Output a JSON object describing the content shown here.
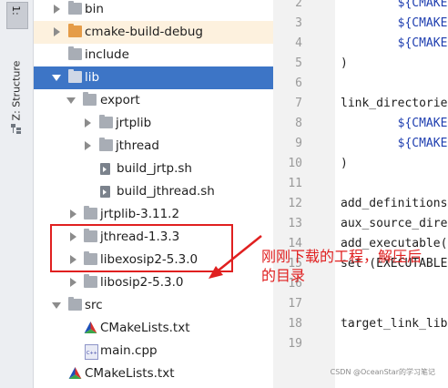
{
  "side_strip": {
    "tab_top_label": "1:",
    "structure_label": "Z: Structure"
  },
  "tree": {
    "rows": [
      {
        "label": "bin",
        "expanded": false,
        "icon": "folder-icon"
      },
      {
        "label": "cmake-build-debug",
        "expanded": false,
        "icon": "folder-icon"
      },
      {
        "label": "include",
        "icon": "folder-icon"
      },
      {
        "label": "lib",
        "expanded": true,
        "icon": "folder-icon",
        "selected": true
      },
      {
        "label": "export",
        "expanded": true,
        "icon": "folder-icon"
      },
      {
        "label": "jrtplib",
        "expanded": false,
        "icon": "folder-icon"
      },
      {
        "label": "jthread",
        "expanded": false,
        "icon": "folder-icon"
      },
      {
        "label": "build_jrtp.sh",
        "icon": "shell-file-icon"
      },
      {
        "label": "build_jthread.sh",
        "icon": "shell-file-icon"
      },
      {
        "label": "jrtplib-3.11.2",
        "expanded": false,
        "icon": "folder-icon"
      },
      {
        "label": "jthread-1.3.3",
        "expanded": false,
        "icon": "folder-icon"
      },
      {
        "label": "libexosip2-5.3.0",
        "expanded": false,
        "icon": "folder-icon"
      },
      {
        "label": "libosip2-5.3.0",
        "expanded": false,
        "icon": "folder-icon"
      },
      {
        "label": "src",
        "expanded": true,
        "icon": "folder-icon"
      },
      {
        "label": "CMakeLists.txt",
        "icon": "cmake-file-icon"
      },
      {
        "label": "main.cpp",
        "icon": "cpp-file-icon"
      },
      {
        "label": "CMakeLists.txt",
        "icon": "cmake-file-icon"
      }
    ]
  },
  "editor": {
    "line_numbers": [
      "2",
      "3",
      "4",
      "5",
      "6",
      "7",
      "8",
      "9",
      "10",
      "11",
      "12",
      "13",
      "14",
      "15",
      "16",
      "17",
      "18",
      "19"
    ],
    "lines": [
      {
        "indent": "        ",
        "text": "${CMAKE",
        "kind": "var"
      },
      {
        "indent": "        ",
        "text": "${CMAKE",
        "kind": "var"
      },
      {
        "indent": "        ",
        "text": "${CMAKE",
        "kind": "var"
      },
      {
        "indent": "",
        "text": ")",
        "kind": "plain"
      },
      {
        "indent": "",
        "text": "",
        "kind": "plain"
      },
      {
        "indent": "",
        "text": "link_directorie",
        "kind": "plain"
      },
      {
        "indent": "        ",
        "text": "${CMAKE",
        "kind": "var"
      },
      {
        "indent": "        ",
        "text": "${CMAKE",
        "kind": "var"
      },
      {
        "indent": "",
        "text": ")",
        "kind": "plain"
      },
      {
        "indent": "",
        "text": "",
        "kind": "plain"
      },
      {
        "indent": "",
        "text": "add_definitions",
        "kind": "plain"
      },
      {
        "indent": "",
        "text": "aux_source_dire",
        "kind": "plain"
      },
      {
        "indent": "",
        "text": "add_executable(",
        "kind": "plain"
      },
      {
        "indent": "",
        "text": "set (EXECUTABLE",
        "kind": "plain"
      },
      {
        "indent": "",
        "text": "",
        "kind": "plain"
      },
      {
        "indent": "",
        "text": "",
        "kind": "plain"
      },
      {
        "indent": "",
        "text": "target_link_lib",
        "kind": "plain"
      },
      {
        "indent": "",
        "text": "",
        "kind": "plain"
      }
    ]
  },
  "annotation": {
    "note": "刚刚下载的工程，解压后的目录",
    "color": "#e02020"
  },
  "watermark": "CSDN @OceanStar的学习笔记",
  "colors": {
    "selection": "#3d75c6",
    "excluded_folder": "#e59c48",
    "folder": "#a8adb5"
  }
}
